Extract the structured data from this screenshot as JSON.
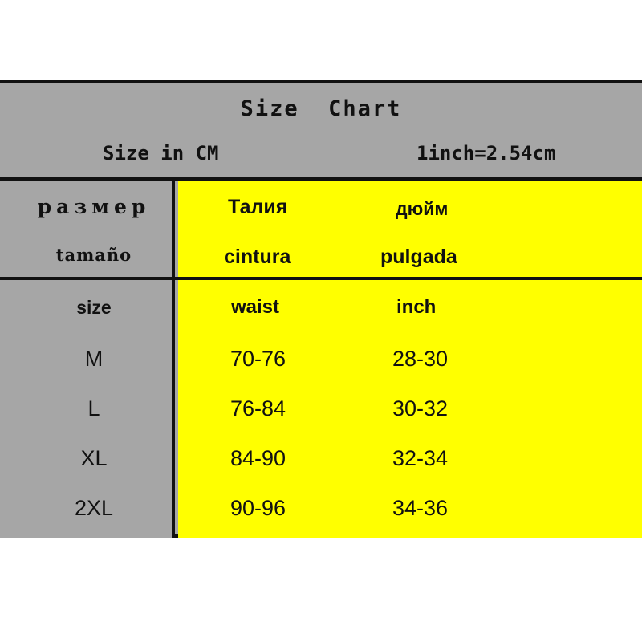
{
  "banner": {
    "title": "Size  Chart",
    "unit_note": "Size in CM",
    "conversion_note": "1inch=2.54cm"
  },
  "colors": {
    "header_background": "#A6A6A6",
    "data_background": "#FFFF00",
    "border": "#111111",
    "text": "#111111"
  },
  "multilingual_headers": {
    "russian": {
      "size": "размер",
      "waist": "Талия",
      "inch": "дюйм"
    },
    "spanish": {
      "size": "tamaño",
      "waist": "cintura",
      "inch": "pulgada"
    },
    "english": {
      "size": "size",
      "waist": "waist",
      "inch": "inch"
    }
  },
  "chart_data": {
    "type": "table",
    "title": "Size  Chart",
    "columns": [
      "size",
      "waist",
      "inch"
    ],
    "rows": [
      {
        "size": "M",
        "waist": "70-76",
        "inch": "28-30"
      },
      {
        "size": "L",
        "waist": "76-84",
        "inch": "30-32"
      },
      {
        "size": "XL",
        "waist": "84-90",
        "inch": "32-34"
      },
      {
        "size": "2XL",
        "waist": "90-96",
        "inch": "34-36"
      }
    ]
  }
}
